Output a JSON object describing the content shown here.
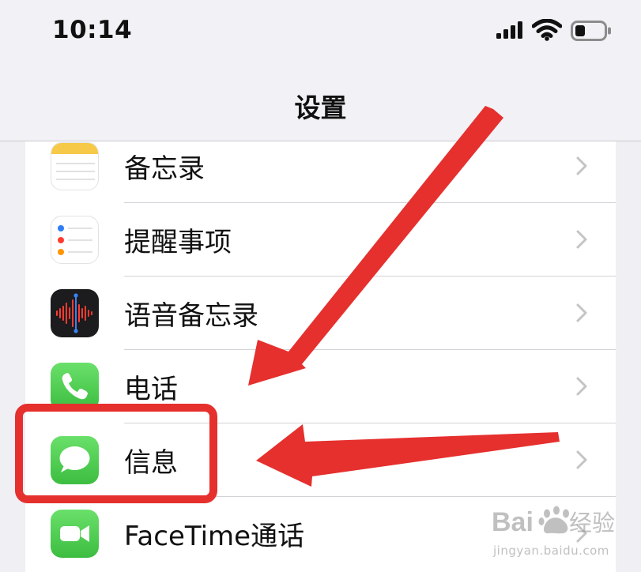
{
  "status_bar": {
    "time": "10:14"
  },
  "nav": {
    "title": "设置"
  },
  "settings_items": [
    {
      "label": "备忘录",
      "icon": "notes-icon"
    },
    {
      "label": "提醒事项",
      "icon": "reminders-icon"
    },
    {
      "label": "语音备忘录",
      "icon": "voice-memos-icon"
    },
    {
      "label": "电话",
      "icon": "phone-icon"
    },
    {
      "label": "信息",
      "icon": "messages-icon"
    },
    {
      "label": "FaceTime通话",
      "icon": "facetime-icon"
    }
  ],
  "annotation": {
    "highlight_color": "#e5302e"
  },
  "watermark": {
    "brand": "Baidu经验",
    "url": "jingyan.baidu.com"
  }
}
